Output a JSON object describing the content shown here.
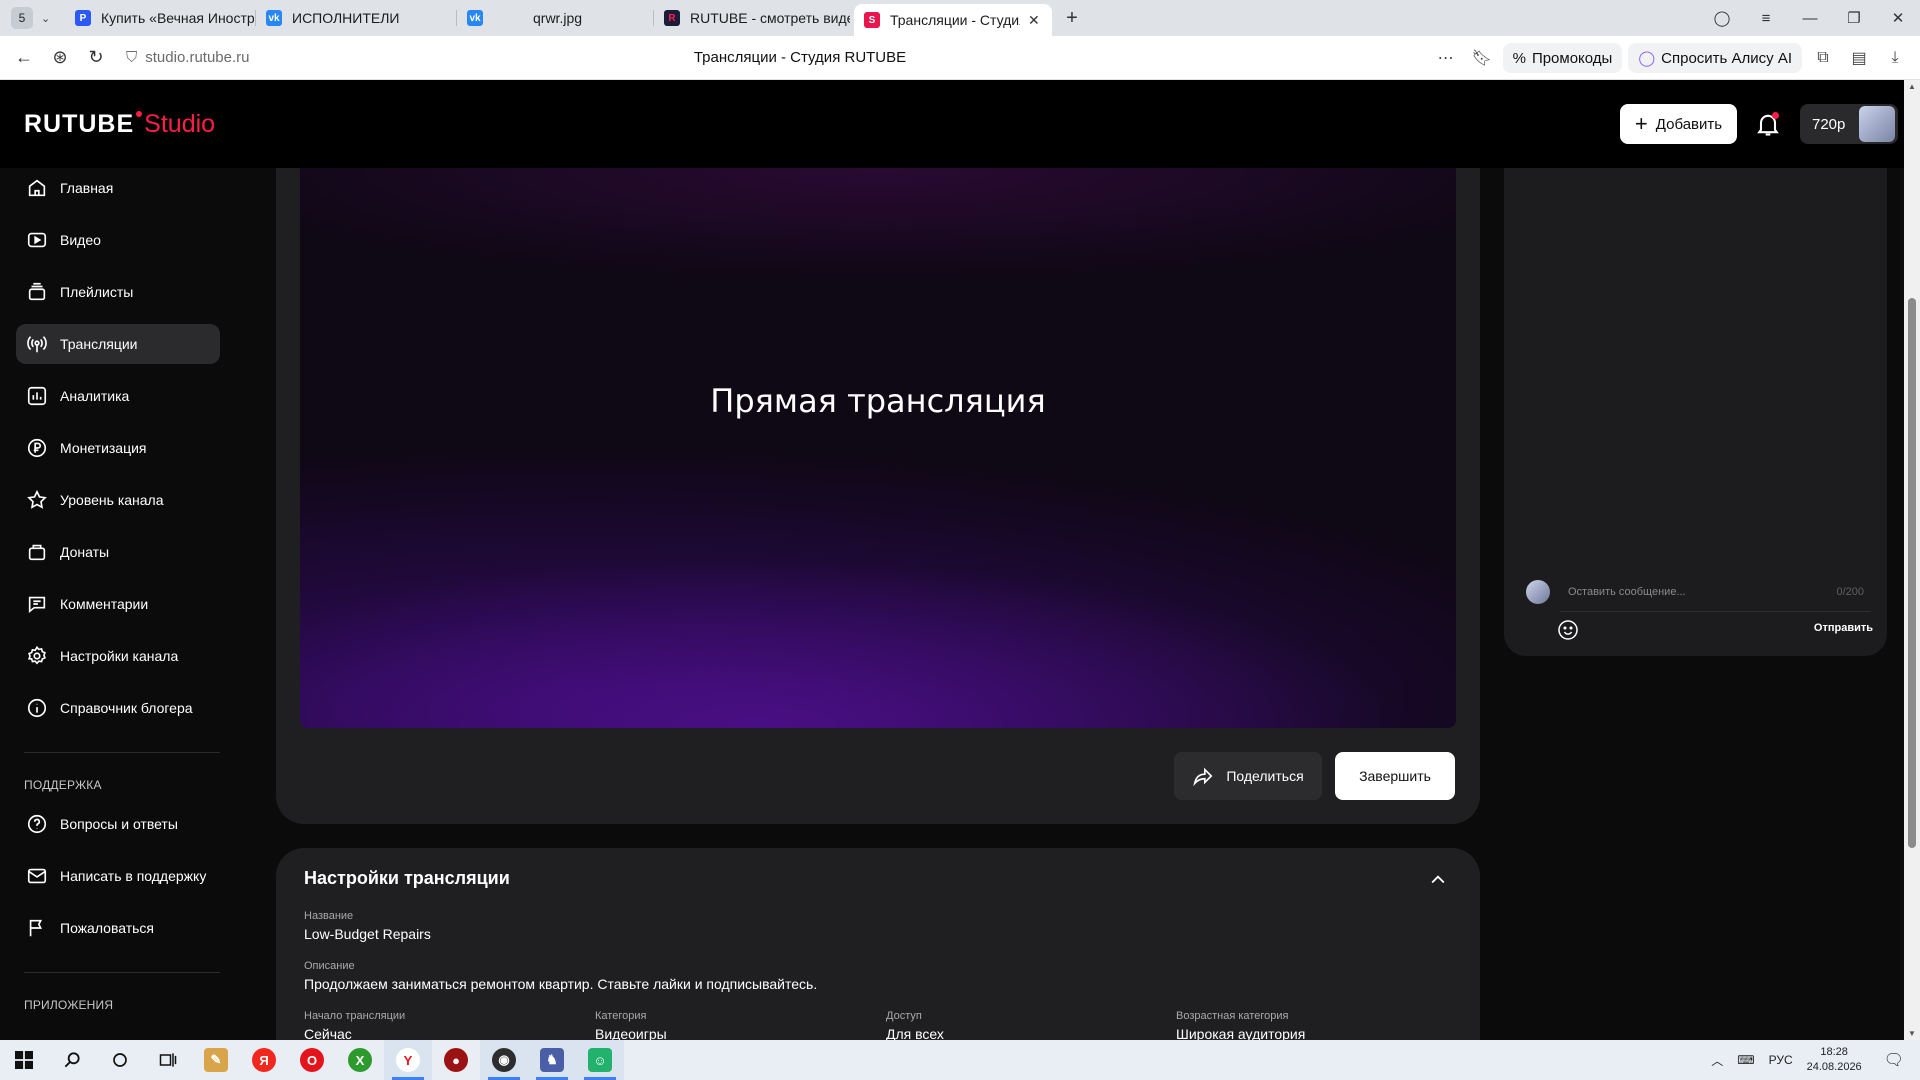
{
  "browser": {
    "tab_count": "5",
    "tabs": [
      {
        "label": "Купить «Вечная Иностра",
        "icon": "rutube-icon",
        "color": "#2b59f5"
      },
      {
        "label": "ИСПОЛНИТЕЛИ",
        "icon": "vk-icon",
        "color": "#2787f5"
      },
      {
        "label": "qrwr.jpg",
        "icon": "vk-icon",
        "color": "#2787f5"
      },
      {
        "label": "RUTUBE - смотреть видео",
        "icon": "rutube-icon",
        "color": "#1b1c3a"
      },
      {
        "label": "Трансляции - Студия RUTUBE",
        "icon": "rutube-studio-icon",
        "color": "#e8164c"
      }
    ],
    "url": "studio.rutube.ru",
    "page_title": "Трансляции - Студия RUTUBE",
    "promo_label": "Промокоды",
    "alice_label": "Спросить Алису AI"
  },
  "header": {
    "logo_text": "RUTUBE",
    "logo_studio": "Studio",
    "add_label": "Добавить",
    "quality_label": "720p",
    "brand_color": "#ff1e46"
  },
  "sidebar": {
    "items": [
      {
        "label": "Главная",
        "icon": "home-icon"
      },
      {
        "label": "Видео",
        "icon": "video-icon"
      },
      {
        "label": "Плейлисты",
        "icon": "playlist-icon"
      },
      {
        "label": "Трансляции",
        "icon": "broadcast-icon",
        "active": true
      },
      {
        "label": "Аналитика",
        "icon": "analytics-icon"
      },
      {
        "label": "Монетизация",
        "icon": "ruble-icon"
      },
      {
        "label": "Уровень канала",
        "icon": "star-icon"
      },
      {
        "label": "Донаты",
        "icon": "donate-icon"
      },
      {
        "label": "Комментарии",
        "icon": "comment-icon"
      },
      {
        "label": "Настройки канала",
        "icon": "gear-icon"
      },
      {
        "label": "Справочник блогера",
        "icon": "info-icon"
      }
    ],
    "support_caption": "ПОДДЕРЖКА",
    "support_items": [
      {
        "label": "Вопросы и ответы",
        "icon": "question-icon"
      },
      {
        "label": "Написать в поддержку",
        "icon": "mail-icon"
      },
      {
        "label": "Пожаловаться",
        "icon": "flag-icon"
      }
    ],
    "apps_caption": "ПРИЛОЖЕНИЯ"
  },
  "player": {
    "title": "Прямая трансляция",
    "share_label": "Поделиться",
    "finish_label": "Завершить"
  },
  "chat": {
    "placeholder": "Оставить сообщение...",
    "counter": "0/200",
    "send_label": "Отправить"
  },
  "settings": {
    "title": "Настройки трансляции",
    "name_label": "Название",
    "name_value": "Low-Budget Repairs",
    "desc_label": "Описание",
    "desc_value": "Продолжаем заниматься ремонтом квартир. Ставьте лайки и подписывайтесь.",
    "fields": [
      {
        "label": "Начало трансляции",
        "value": "Сейчас"
      },
      {
        "label": "Категория",
        "value": "Видеоигры"
      },
      {
        "label": "Доступ",
        "value": "Для всех"
      },
      {
        "label": "Возрастная категория",
        "value": "Широкая аудитория"
      }
    ]
  },
  "taskbar": {
    "lang": "РУС",
    "time": "18:28",
    "date": "24.08.2026",
    "apps": [
      {
        "name": "paint-icon",
        "color": "#d9a54a",
        "glyph": "✎"
      },
      {
        "name": "yandex-icon",
        "color": "#f2281e",
        "glyph": "Я"
      },
      {
        "name": "opera-icon",
        "color": "#e3141c",
        "glyph": "O"
      },
      {
        "name": "xbox-icon",
        "color": "#2c9a2c",
        "glyph": "X"
      },
      {
        "name": "yandex-browser-icon",
        "color": "#ffffff",
        "glyph": "Y"
      },
      {
        "name": "app-red-icon",
        "color": "#9b1212",
        "glyph": "●"
      },
      {
        "name": "obs-icon",
        "color": "#2d2d2d",
        "glyph": "◉"
      },
      {
        "name": "game-icon",
        "color": "#4b5fa8",
        "glyph": "♞"
      },
      {
        "name": "discord-icon",
        "color": "#23b26d",
        "glyph": "☺"
      }
    ]
  }
}
